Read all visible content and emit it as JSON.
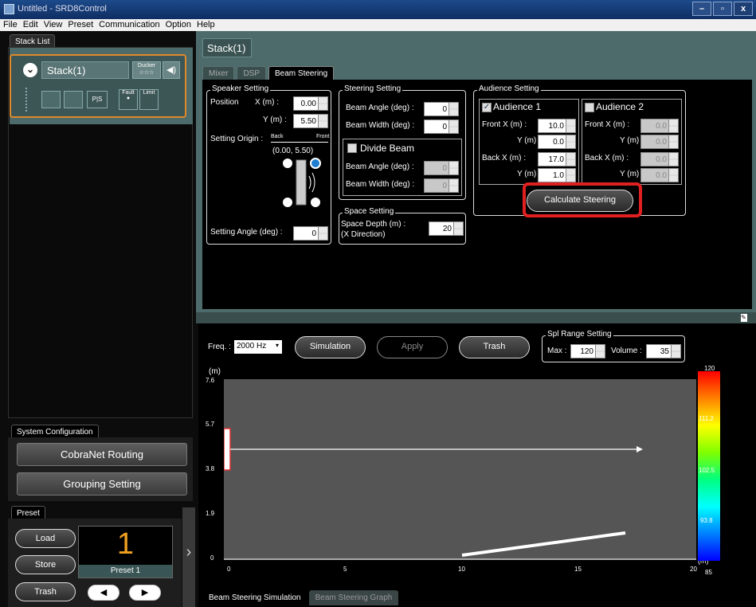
{
  "window": {
    "title": "Untitled - SRD8Control",
    "controls": [
      "–",
      "▫",
      "x"
    ]
  },
  "menu": [
    "File",
    "Edit",
    "View",
    "Preset",
    "Communication",
    "Option",
    "Help"
  ],
  "left": {
    "stack_list_tab": "Stack List",
    "stack_name": "Stack(1)",
    "ducker": "Ducker",
    "ducker_stars": "☆☆☆",
    "fault": "Fault",
    "limit": "Limit",
    "ps": "P|S",
    "sysconf_tab": "System Configuration",
    "cobranet": "CobraNet Routing",
    "grouping": "Grouping Setting",
    "preset_tab": "Preset",
    "load": "Load",
    "store": "Store",
    "trash": "Trash",
    "preset_number": "1",
    "preset_name": "Preset 1"
  },
  "main": {
    "stack_title": "Stack(1)",
    "tabs": [
      "Mixer",
      "DSP",
      "Beam Steering"
    ],
    "speaker": {
      "title": "Speaker Setting",
      "position": "Position",
      "x_label": "X (m) :",
      "x": "0.00",
      "y_label": "Y (m) :",
      "y": "5.50",
      "origin": "Setting Origin :",
      "back": "Back",
      "front": "Front",
      "coords": "(0.00, 5.50)",
      "angle_label": "Setting Angle (deg) :",
      "angle": "0"
    },
    "steering": {
      "title": "Steering Setting",
      "beam_angle": "Beam Angle (deg) :",
      "beam_angle_val": "0",
      "beam_width": "Beam Width (deg) :",
      "beam_width_val": "0",
      "divide": "Divide Beam",
      "div_angle_val": "0",
      "div_width_val": "0"
    },
    "space": {
      "title": "Space Setting",
      "depth": "Space Depth (m) :",
      "xdir": "(X Direction)",
      "val": "20"
    },
    "audience": {
      "title": "Audience Setting",
      "a1": "Audience 1",
      "a2": "Audience 2",
      "front_x": "Front  X (m) :",
      "y": "Y (m) :",
      "back_x": "Back  X (m) :",
      "a1_vals": [
        "10.0",
        "0.0",
        "17.0",
        "1.0"
      ],
      "a2_vals": [
        "0.0",
        "0.0",
        "0.0",
        "0.0"
      ]
    },
    "calculate": "Calculate Steering"
  },
  "lower": {
    "freq_label": "Freq. :",
    "freq": "2000 Hz",
    "simulation": "Simulation",
    "apply": "Apply",
    "trash": "Trash",
    "spl_title": "Spl Range Setting",
    "max_label": "Max :",
    "max": "120",
    "volume_label": "Volume :",
    "volume": "35",
    "y_unit": "(m)",
    "x_unit": "(m)",
    "y_ticks": [
      "7.6",
      "5.7",
      "3.8",
      "1.9",
      "0"
    ],
    "x_ticks": [
      "0",
      "5",
      "10",
      "15",
      "20"
    ],
    "cb_ticks": [
      "120",
      "111.2",
      "102.5",
      "93.8",
      "85"
    ],
    "tabs": [
      "Beam Steering Simulation",
      "Beam Steering Graph"
    ]
  }
}
